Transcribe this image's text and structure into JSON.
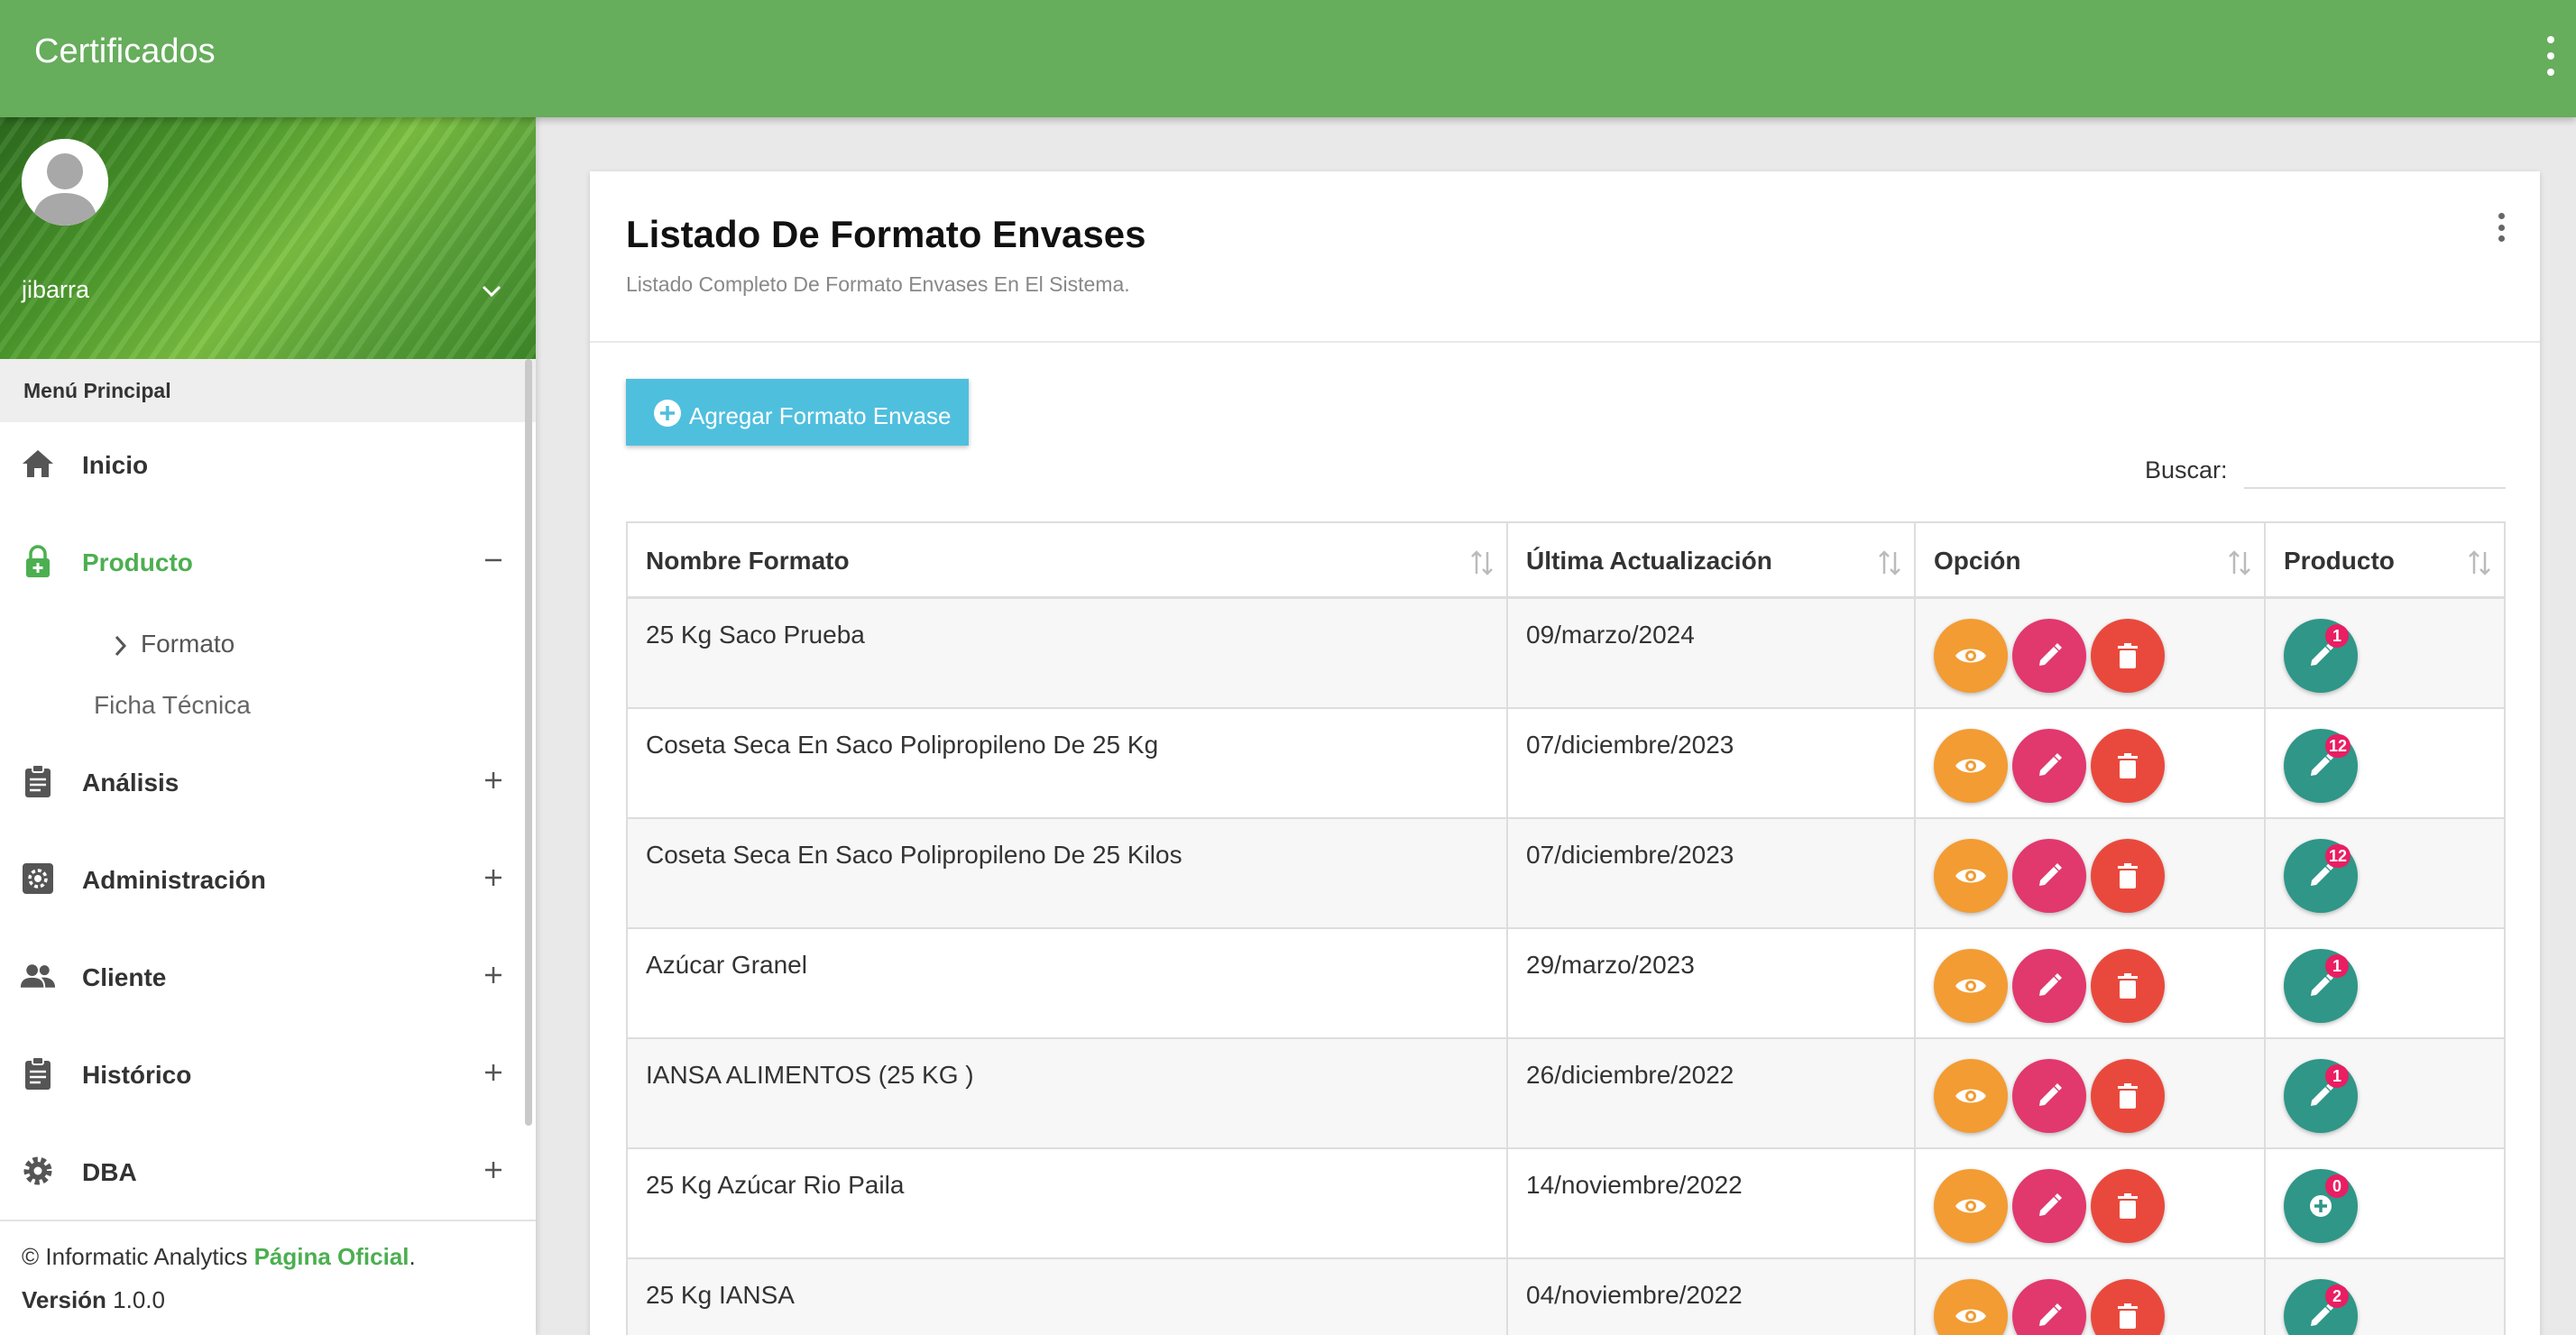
{
  "app": {
    "title": "Certificados"
  },
  "user": {
    "name": "jibarra"
  },
  "sidebar": {
    "header": "Menú Principal",
    "items": [
      {
        "label": "Inicio",
        "icon": "home-icon"
      },
      {
        "label": "Producto",
        "icon": "lock-icon",
        "active": true,
        "expanded": true
      },
      {
        "label": "Análisis",
        "icon": "clipboard-icon"
      },
      {
        "label": "Administración",
        "icon": "gear-box-icon"
      },
      {
        "label": "Cliente",
        "icon": "people-icon"
      },
      {
        "label": "Histórico",
        "icon": "clipboard-icon"
      },
      {
        "label": "DBA",
        "icon": "gear-icon"
      }
    ],
    "subitems": [
      {
        "label": "Formato",
        "active": true
      },
      {
        "label": "Ficha Técnica"
      }
    ],
    "footer": {
      "copyright_prefix": "© Informatic Analytics ",
      "link_text": "Página Oficial",
      "copyright_suffix": ".",
      "version_label": "Versión",
      "version_value": " 1.0.0"
    }
  },
  "card": {
    "title": "Listado De Formato Envases",
    "subtitle": "Listado Completo De Formato Envases En El Sistema.",
    "add_button": "Agregar Formato Envase",
    "search_label": "Buscar:",
    "search_value": ""
  },
  "table": {
    "columns": [
      "Nombre Formato",
      "Última Actualización",
      "Opción",
      "Producto"
    ],
    "rows": [
      {
        "name": "25 Kg Saco Prueba",
        "date": "09/marzo/2024",
        "badge": "1",
        "prod_icon": "pencil-icon"
      },
      {
        "name": "Coseta Seca En Saco Polipropileno De 25 Kg",
        "date": "07/diciembre/2023",
        "badge": "12",
        "prod_icon": "pencil-icon"
      },
      {
        "name": "Coseta Seca En Saco Polipropileno De 25 Kilos",
        "date": "07/diciembre/2023",
        "badge": "12",
        "prod_icon": "pencil-icon"
      },
      {
        "name": "Azúcar Granel",
        "date": "29/marzo/2023",
        "badge": "1",
        "prod_icon": "pencil-icon"
      },
      {
        "name": "IANSA ALIMENTOS (25 KG )",
        "date": "26/diciembre/2022",
        "badge": "1",
        "prod_icon": "pencil-icon"
      },
      {
        "name": "25 Kg Azúcar Rio Paila",
        "date": "14/noviembre/2022",
        "badge": "0",
        "prod_icon": "plus-circle-icon"
      },
      {
        "name": "25 Kg IANSA",
        "date": "04/noviembre/2022",
        "badge": "2",
        "prod_icon": "pencil-icon"
      }
    ]
  },
  "colors": {
    "topbar": "#66ad5c",
    "accent_green": "#4caf50",
    "add_button": "#4fbfde",
    "view": "#f39c33",
    "edit": "#e1386e",
    "delete": "#e9493d",
    "product": "#2f9688",
    "badge": "#e91e63"
  }
}
